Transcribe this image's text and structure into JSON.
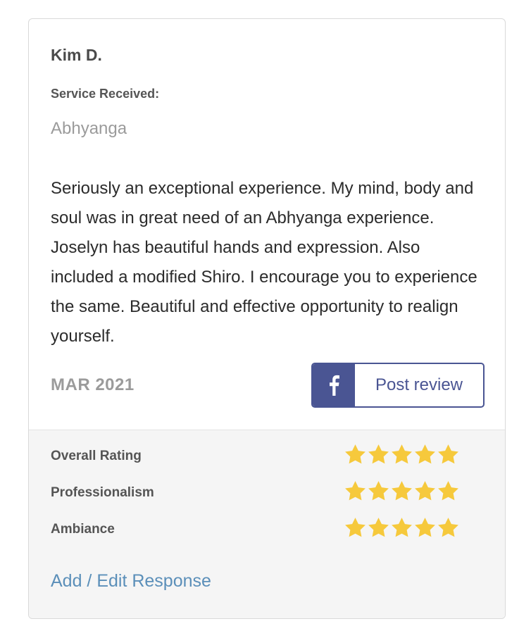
{
  "review": {
    "reviewer_name": "Kim D.",
    "service_label": "Service Received:",
    "service_value": "Abhyanga",
    "text": "Seriously an exceptional experience. My mind, body and soul was in great need of an Abhyanga experience. Joselyn has beautiful hands and expression. Also included a modified Shiro. I encourage you to experience the same. Beautiful and effective opportunity to realign yourself.",
    "date": "MAR 2021",
    "facebook_button": {
      "icon": "facebook-icon",
      "label": "Post review"
    }
  },
  "ratings": [
    {
      "label": "Overall Rating",
      "stars": 5,
      "max_stars": 5
    },
    {
      "label": "Professionalism",
      "stars": 5,
      "max_stars": 5
    },
    {
      "label": "Ambiance",
      "stars": 5,
      "max_stars": 5
    }
  ],
  "response_link": "Add / Edit Response",
  "colors": {
    "facebook": "#4a5593",
    "star": "#f6c93c",
    "link": "#5b8fb9"
  }
}
